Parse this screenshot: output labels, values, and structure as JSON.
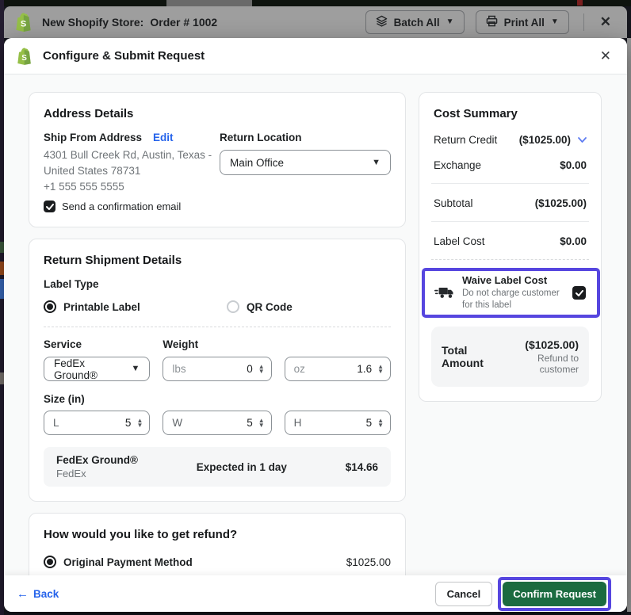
{
  "topbar": {
    "store_name": "New Shopify Store:",
    "order_label": "Order # 1002",
    "batch_all_label": "Batch All",
    "print_all_label": "Print All",
    "close_glyph": "✕"
  },
  "modal": {
    "title": "Configure & Submit Request",
    "close_glyph": "✕"
  },
  "address": {
    "heading": "Address Details",
    "ship_from_label": "Ship From Address",
    "edit_label": "Edit",
    "line1": "4301 Bull Creek Rd, Austin, Texas -",
    "line2": "United States 78731",
    "phone": "+1 555 555 5555",
    "confirmation_label": "Send a confirmation email",
    "return_location_label": "Return Location",
    "return_location_value": "Main Office"
  },
  "shipment": {
    "heading": "Return Shipment Details",
    "label_type_label": "Label Type",
    "printable_label": "Printable Label",
    "qr_code_label": "QR Code",
    "service_label": "Service",
    "service_value": "FedEx Ground®",
    "weight_label": "Weight",
    "lbs_unit": "lbs",
    "lbs_value": "0",
    "oz_unit": "oz",
    "oz_value": "1.6",
    "size_label": "Size (in)",
    "l_unit": "L",
    "l_value": "5",
    "w_unit": "W",
    "w_value": "5",
    "h_unit": "H",
    "h_value": "5",
    "rate": {
      "name": "FedEx Ground®",
      "carrier": "FedEx",
      "eta": "Expected in 1 day",
      "price": "$14.66"
    }
  },
  "refund": {
    "heading": "How would you like to get refund?",
    "option_label": "Original Payment Method",
    "amount": "$1025.00"
  },
  "cost_summary": {
    "heading": "Cost Summary",
    "rows": [
      {
        "label": "Return Credit",
        "value": "($1025.00)"
      },
      {
        "label": "Exchange",
        "value": "$0.00"
      },
      {
        "label": "Subtotal",
        "value": "($1025.00)"
      },
      {
        "label": "Label Cost",
        "value": "$0.00"
      }
    ],
    "waive": {
      "title": "Waive Label Cost",
      "desc": "Do not charge customer for this label"
    },
    "total": {
      "label": "Total Amount",
      "value": "($1025.00)",
      "note": "Refund to customer"
    }
  },
  "footer": {
    "back_label": "Back",
    "cancel_label": "Cancel",
    "confirm_label": "Confirm Request"
  },
  "colors": {
    "highlight_purple": "#5646df",
    "confirm_green": "#1b6b40",
    "link_blue": "#2563eb",
    "shopify_green": "#95bf47"
  }
}
